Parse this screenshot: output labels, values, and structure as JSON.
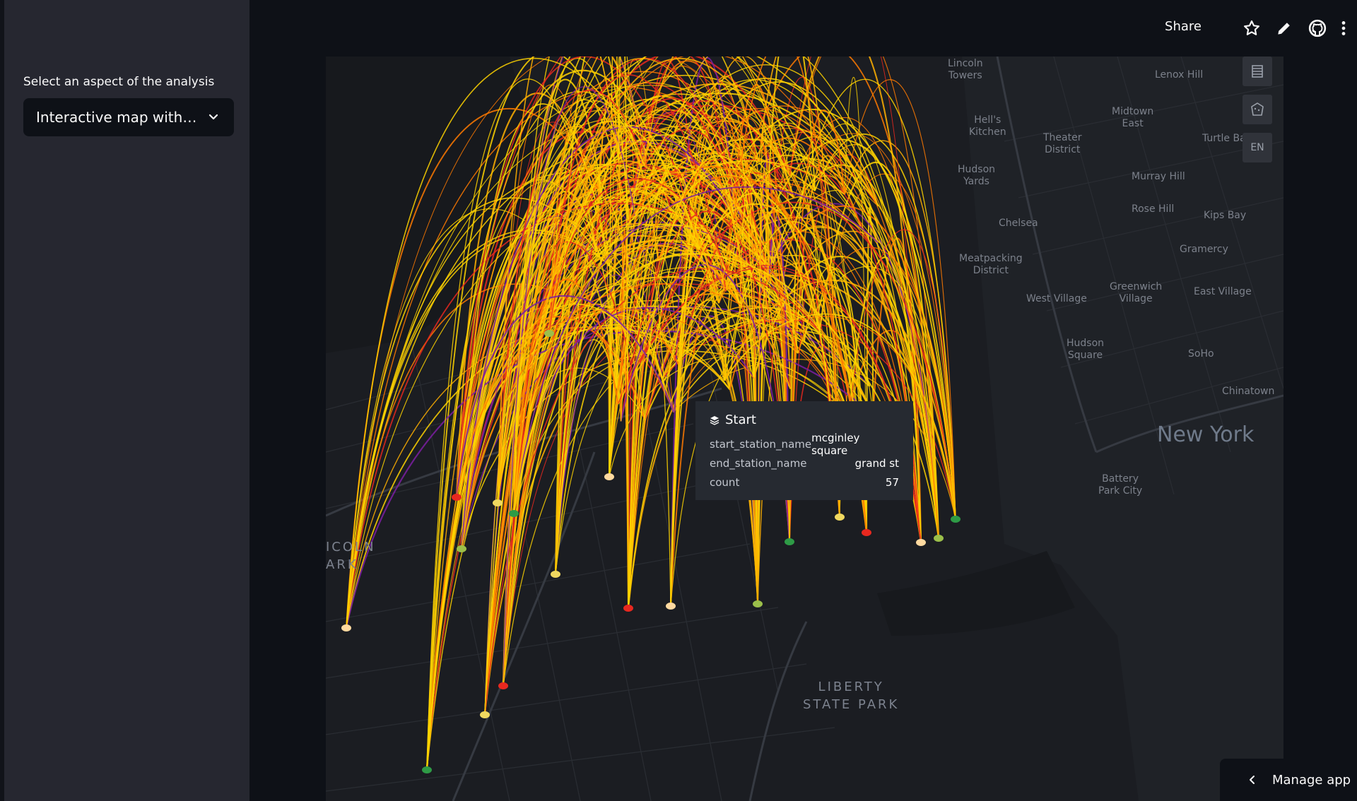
{
  "sidebar": {
    "select_label": "Select an aspect of the analysis",
    "select_value": "Interactive map with aggregated bike trips"
  },
  "header": {
    "share_label": "Share",
    "icons": [
      "star-icon",
      "pencil-icon",
      "github-icon",
      "more-vertical-icon"
    ]
  },
  "map": {
    "controls": {
      "language_label": "EN"
    },
    "places": [
      {
        "label": "Lincoln\nTowers"
      },
      {
        "label": "Lenox Hill"
      },
      {
        "label": "Hell's\nKitchen"
      },
      {
        "label": "Midtown\nEast"
      },
      {
        "label": "Theater\nDistrict"
      },
      {
        "label": "Turtle Bay"
      },
      {
        "label": "Hudson\nYards"
      },
      {
        "label": "Murray Hill"
      },
      {
        "label": "Chelsea"
      },
      {
        "label": "Rose Hill"
      },
      {
        "label": "Kips Bay"
      },
      {
        "label": "Gramercy"
      },
      {
        "label": "Meatpacking\nDistrict"
      },
      {
        "label": "Greenwich\nVillage"
      },
      {
        "label": "East Village"
      },
      {
        "label": "West Village"
      },
      {
        "label": "Hudson\nSquare"
      },
      {
        "label": "SoHo"
      },
      {
        "label": "Chinatown"
      },
      {
        "label": "New York"
      },
      {
        "label": "Battery\nPark City"
      },
      {
        "label": "ICOLN\nARK"
      },
      {
        "label": "LIBERTY\nSTATE PARK"
      }
    ],
    "arc_colors": [
      "#ffd400",
      "#ffb000",
      "#ff7a00",
      "#e8281f",
      "#7b1fa2"
    ]
  },
  "tooltip": {
    "title": "Start",
    "rows": [
      {
        "key": "start_station_name",
        "value": "mcginley square"
      },
      {
        "key": "end_station_name",
        "value": "grand st"
      },
      {
        "key": "count",
        "value": "57"
      }
    ]
  },
  "footer": {
    "manage_label": "Manage app"
  }
}
